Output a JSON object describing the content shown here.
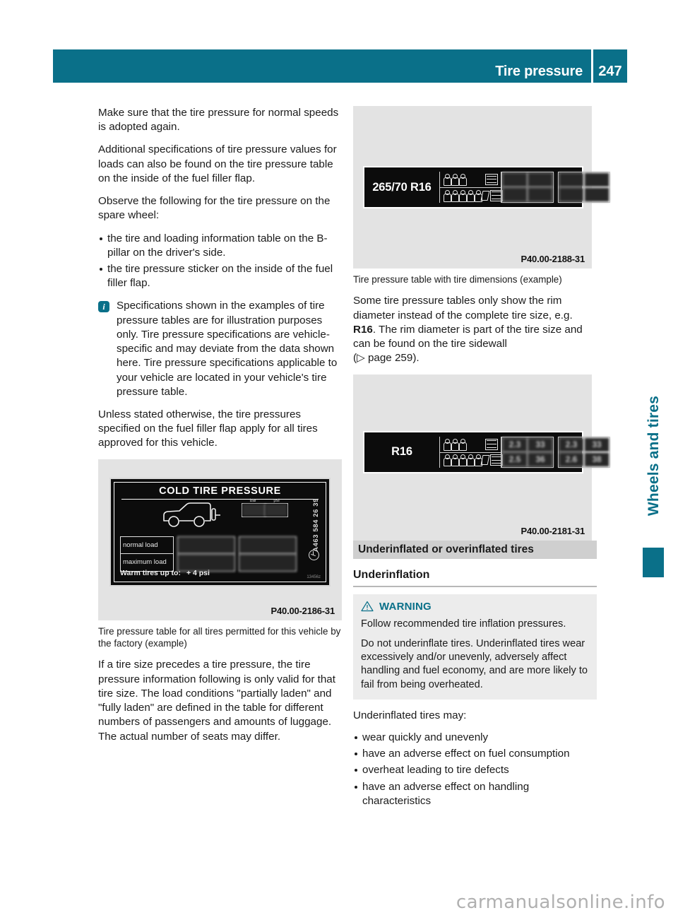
{
  "header": {
    "title": "Tire pressure",
    "page_number": "247"
  },
  "left_column": {
    "paragraph_1": "Make sure that the tire pressure for normal speeds is adopted again.",
    "paragraph_2": "Additional specifications of tire pressure values for loads can also be found on the tire pressure table on the inside of the fuel filler flap.",
    "paragraph_3": "Observe the following for the tire pressure on the spare wheel:",
    "bullets": [
      "the tire and loading information table on the B-pillar on the driver's side.",
      "the tire pressure sticker on the inside of the fuel filler flap."
    ],
    "note": {
      "icon": "info-icon",
      "icon_glyph": "i",
      "text": "Specifications shown in the examples of tire pressure tables are for illustration purposes only. Tire pressure specifications are vehicle-specific and may deviate from the data shown here. Tire pressure specifications applicable to your vehicle are located in your vehicle's tire pressure table."
    },
    "paragraph_4": "Unless stated otherwise, the tire pressures specified on the fuel filler flap apply for all tires approved for this vehicle.",
    "figure": {
      "code": "P40.00-2186-31",
      "sticker": {
        "title": "COLD TIRE PRESSURE",
        "unit_labels": [
          "bar",
          "psi"
        ],
        "unit_values": [
          "",
          ""
        ],
        "rows": [
          {
            "label": "normal load",
            "values": [
              "",
              ""
            ]
          },
          {
            "label": "maximum load",
            "values": [
              "",
              ""
            ]
          }
        ],
        "warm_label": "Warm tires up to:",
        "warm_value": "+ 4 psi",
        "part_number": "A463 584 26 39",
        "small_code": "13456z"
      }
    },
    "caption": "Tire pressure table for all tires permitted for this vehicle by the factory (example)",
    "paragraph_5": "If a tire size precedes a tire pressure, the tire pressure information following is only valid for that tire size. The load conditions \"partially laden\" and \"fully laden\" are defined in the table for different numbers of passengers and amounts of luggage. The actual number of seats may differ."
  },
  "right_column": {
    "figure_1": {
      "code": "P40.00-2188-31",
      "tire_size": "265/70 R16",
      "rows": [
        {
          "occupants": 3,
          "luggage": "stack",
          "values": [
            "",
            "",
            "",
            ""
          ]
        },
        {
          "occupants": 5,
          "luggage": "stack-bag",
          "values": [
            "",
            "",
            "",
            ""
          ]
        }
      ]
    },
    "caption_1": "Tire pressure table with tire dimensions (example)",
    "paragraph_1_before": "Some tire pressure tables only show the rim diameter instead of the complete tire size, e.g. ",
    "paragraph_1_bold": "R16",
    "paragraph_1_after": ". The rim diameter is part of the tire size and can be found on the tire sidewall",
    "page_ref_open": "(",
    "page_ref_arrow": "▷",
    "page_ref_text": " page 259).",
    "figure_2": {
      "code": "P40.00-2181-31",
      "tire_size": "R16",
      "rows": [
        {
          "occupants": 3,
          "luggage": "stack",
          "values": [
            "2.3",
            "33",
            "2.3",
            "33"
          ]
        },
        {
          "occupants": 5,
          "luggage": "stack-bag",
          "values": [
            "2.5",
            "36",
            "2.6",
            "38"
          ]
        }
      ]
    },
    "section_heading": "Underinflated or overinflated tires",
    "sub_heading": "Underinflation",
    "warning": {
      "icon": "warning-triangle-icon",
      "label": "WARNING",
      "paragraph_1": "Follow recommended tire inflation pressures.",
      "paragraph_2": "Do not underinflate tires. Underinflated tires wear excessively and/or unevenly, adversely affect handling and fuel economy, and are more likely to fail from being overheated."
    },
    "list_intro": "Underinflated tires may:",
    "bullets": [
      "wear quickly and unevenly",
      "have an adverse effect on fuel consumption",
      "overheat leading to tire defects",
      "have an adverse effect on handling characteristics"
    ]
  },
  "side_tab": {
    "label": "Wheels and tires"
  },
  "watermark": "carmanualsonline.info",
  "colors": {
    "accent_teal": "#0a7089",
    "section_heading_bg": "#cfcfcf",
    "warning_bg": "#ececec",
    "figure_bg": "#e3e3e3"
  }
}
